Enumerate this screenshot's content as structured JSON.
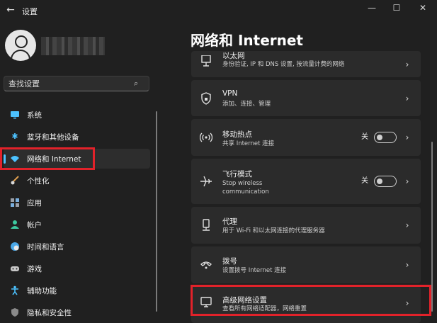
{
  "window": {
    "title": "设置",
    "minimize": "—",
    "maximize": "☐",
    "close": "✕"
  },
  "search": {
    "placeholder": "查找设置"
  },
  "sidebar": {
    "items": [
      {
        "label": "系统",
        "icon": "monitor-icon"
      },
      {
        "label": "蓝牙和其他设备",
        "icon": "bluetooth-icon"
      },
      {
        "label": "网络和 Internet",
        "icon": "wifi-icon",
        "active": true
      },
      {
        "label": "个性化",
        "icon": "brush-icon"
      },
      {
        "label": "应用",
        "icon": "apps-icon"
      },
      {
        "label": "帐户",
        "icon": "person-icon"
      },
      {
        "label": "时间和语言",
        "icon": "globe-clock-icon"
      },
      {
        "label": "游戏",
        "icon": "gamepad-icon"
      },
      {
        "label": "辅助功能",
        "icon": "accessibility-icon"
      },
      {
        "label": "隐私和安全性",
        "icon": "shield-icon"
      }
    ]
  },
  "main": {
    "title": "网络和 Internet",
    "cards": [
      {
        "title": "以太网",
        "subtitle": "身份验证, IP 和 DNS 设置, 按流量计费的网络",
        "icon": "ethernet-icon"
      },
      {
        "title": "VPN",
        "subtitle": "添加、连接、管理",
        "icon": "vpn-shield-icon"
      },
      {
        "title": "移动热点",
        "subtitle": "共享 Internet 连接",
        "icon": "hotspot-icon",
        "toggle_label": "关"
      },
      {
        "title": "飞行模式",
        "subtitle_line1": "Stop wireless",
        "subtitle_line2": "communication",
        "icon": "airplane-icon",
        "toggle_label": "关"
      },
      {
        "title": "代理",
        "subtitle": "用于 Wi-Fi 和以太网连接的代理服务器",
        "icon": "proxy-icon"
      },
      {
        "title": "拨号",
        "subtitle": "设置拨号 Internet 连接",
        "icon": "dialup-icon"
      },
      {
        "title": "高级网络设置",
        "subtitle": "查看所有网络适配器，网络重置",
        "icon": "advanced-network-icon"
      }
    ]
  },
  "colors": {
    "accent": "#4cc2ff",
    "highlight": "#e2222a",
    "background": "#202020",
    "card": "#2b2b2b"
  }
}
